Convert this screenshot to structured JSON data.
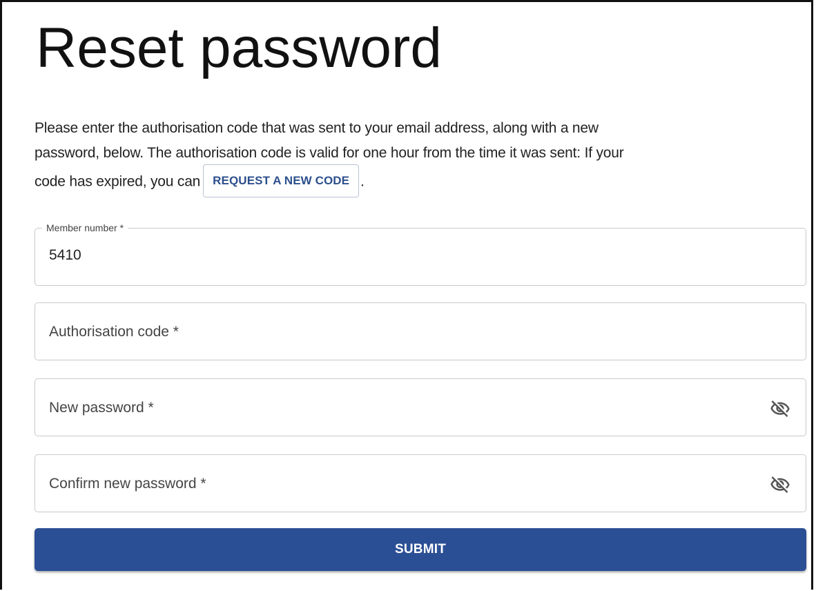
{
  "page": {
    "title": "Reset password"
  },
  "intro": {
    "line1": "Please enter the authorisation code that was sent to your email address, along with a new",
    "line2": "password, below. The authorisation code is valid for one hour from the time it was sent: If your",
    "line3_prefix": "code has expired, you can",
    "request_code_label": "REQUEST A NEW CODE",
    "line3_suffix": "."
  },
  "form": {
    "member_number": {
      "label": "Member number *",
      "value": "5410"
    },
    "authorisation_code": {
      "placeholder": "Authorisation code *"
    },
    "new_password": {
      "placeholder": "New password *",
      "toggle_icon": "visibility-off-icon"
    },
    "confirm_password": {
      "placeholder": "Confirm new password *",
      "toggle_icon": "visibility-off-icon"
    },
    "submit_label": "SUBMIT"
  },
  "colors": {
    "primary": "#2b4f95",
    "link_text": "#2c4f8c",
    "field_border": "#c9c9c9",
    "icon": "#555555"
  }
}
